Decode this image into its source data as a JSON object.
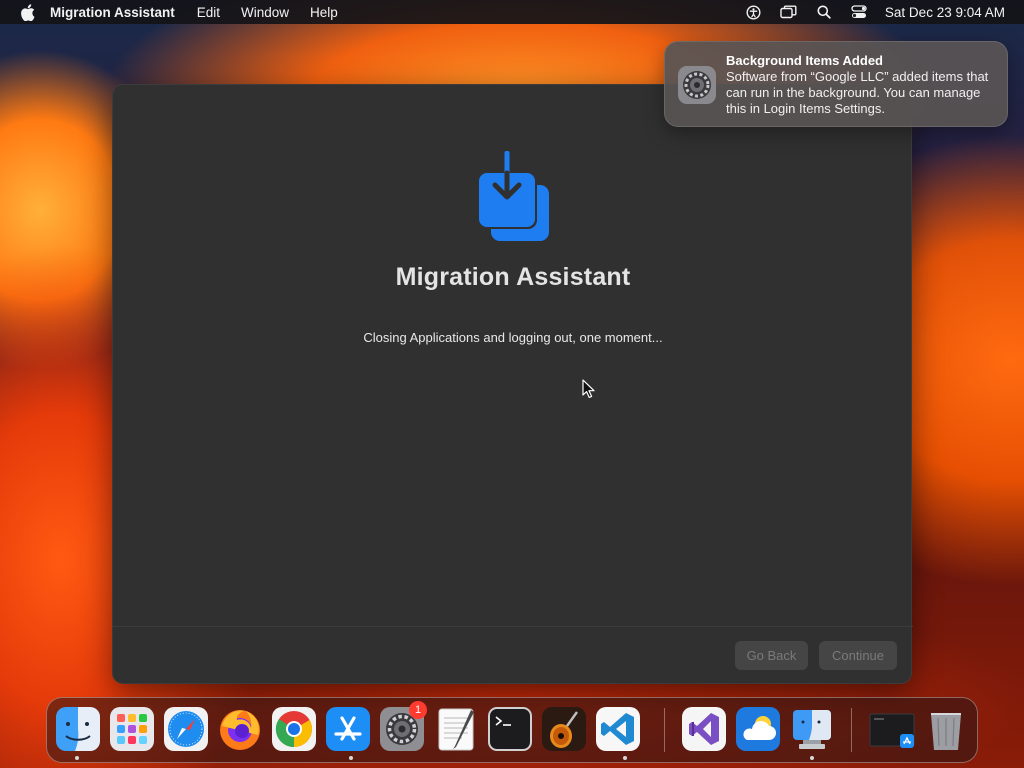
{
  "menubar": {
    "app_name": "Migration Assistant",
    "menus": [
      "Edit",
      "Window",
      "Help"
    ],
    "status_icons": [
      "accessibility-icon",
      "screen-mirroring-icon",
      "spotlight-search-icon",
      "control-center-icon"
    ],
    "clock": "Sat Dec 23  9:04 AM"
  },
  "window": {
    "title": "Migration Assistant",
    "status_text": "Closing Applications and logging out, one moment...",
    "buttons": {
      "back": "Go Back",
      "continue": "Continue"
    },
    "icon": "migration-download-icon",
    "accent_color": "#1e7df0"
  },
  "notification": {
    "title": "Background Items Added",
    "body": "Software from “Google LLC” added items that can run in the background. You can manage this in Login Items Settings.",
    "icon": "system-settings-icon"
  },
  "dock": {
    "apps": [
      {
        "name": "Finder",
        "icon": "finder-icon",
        "running": true
      },
      {
        "name": "Launchpad",
        "icon": "launchpad-icon",
        "running": false
      },
      {
        "name": "Safari",
        "icon": "safari-icon",
        "running": false
      },
      {
        "name": "Firefox",
        "icon": "firefox-icon",
        "running": false
      },
      {
        "name": "Google Chrome",
        "icon": "chrome-icon",
        "running": false
      },
      {
        "name": "App Store",
        "icon": "app-store-icon",
        "running": true
      },
      {
        "name": "System Settings",
        "icon": "system-settings-icon",
        "running": false,
        "badge": "1"
      },
      {
        "name": "TextEdit",
        "icon": "textedit-icon",
        "running": false
      },
      {
        "name": "Terminal",
        "icon": "terminal-icon",
        "running": false
      },
      {
        "name": "GarageBand",
        "icon": "garageband-icon",
        "running": false
      },
      {
        "name": "Visual Studio Code",
        "icon": "vscode-icon",
        "running": true
      },
      {
        "name": "Visual Studio",
        "icon": "visual-studio-icon",
        "running": false
      },
      {
        "name": "Weather",
        "icon": "weather-icon",
        "running": false
      },
      {
        "name": "Migration Assistant",
        "icon": "migration-assistant-icon",
        "running": true
      },
      {
        "name": "Downloads",
        "icon": "downloads-stack-icon",
        "running": false
      },
      {
        "name": "Trash",
        "icon": "trash-icon",
        "running": false
      }
    ]
  }
}
